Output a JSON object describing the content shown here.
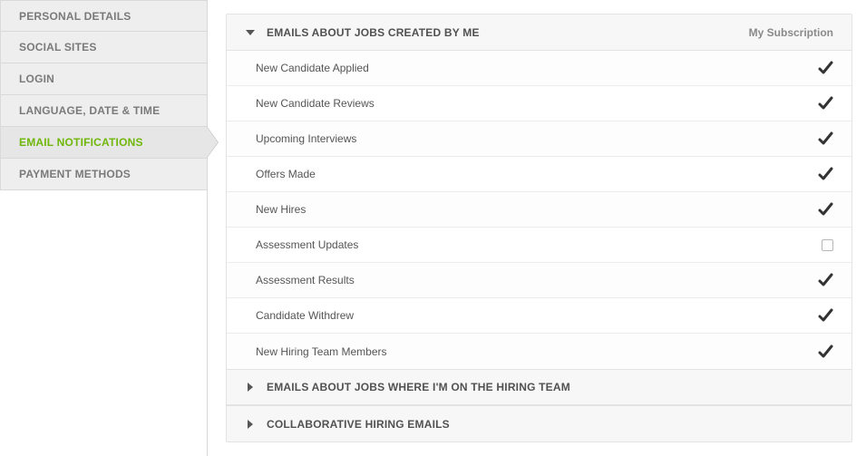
{
  "sidebar": {
    "items": [
      {
        "label": "PERSONAL DETAILS",
        "active": false
      },
      {
        "label": "SOCIAL SITES",
        "active": false
      },
      {
        "label": "LOGIN",
        "active": false
      },
      {
        "label": "LANGUAGE, DATE & TIME",
        "active": false
      },
      {
        "label": "EMAIL NOTIFICATIONS",
        "active": true
      },
      {
        "label": "PAYMENT METHODS",
        "active": false
      }
    ]
  },
  "sections": [
    {
      "title": "EMAILS ABOUT JOBS CREATED BY ME",
      "expanded": true,
      "column_label": "My Subscription",
      "rows": [
        {
          "label": "New Candidate Applied",
          "checked": true
        },
        {
          "label": "New Candidate Reviews",
          "checked": true
        },
        {
          "label": "Upcoming Interviews",
          "checked": true
        },
        {
          "label": "Offers Made",
          "checked": true
        },
        {
          "label": "New Hires",
          "checked": true
        },
        {
          "label": "Assessment Updates",
          "checked": false
        },
        {
          "label": "Assessment Results",
          "checked": true
        },
        {
          "label": "Candidate Withdrew",
          "checked": true
        },
        {
          "label": "New Hiring Team Members",
          "checked": true
        }
      ]
    },
    {
      "title": "EMAILS ABOUT JOBS WHERE I'M ON THE HIRING TEAM",
      "expanded": false
    },
    {
      "title": "COLLABORATIVE HIRING EMAILS",
      "expanded": false
    }
  ]
}
